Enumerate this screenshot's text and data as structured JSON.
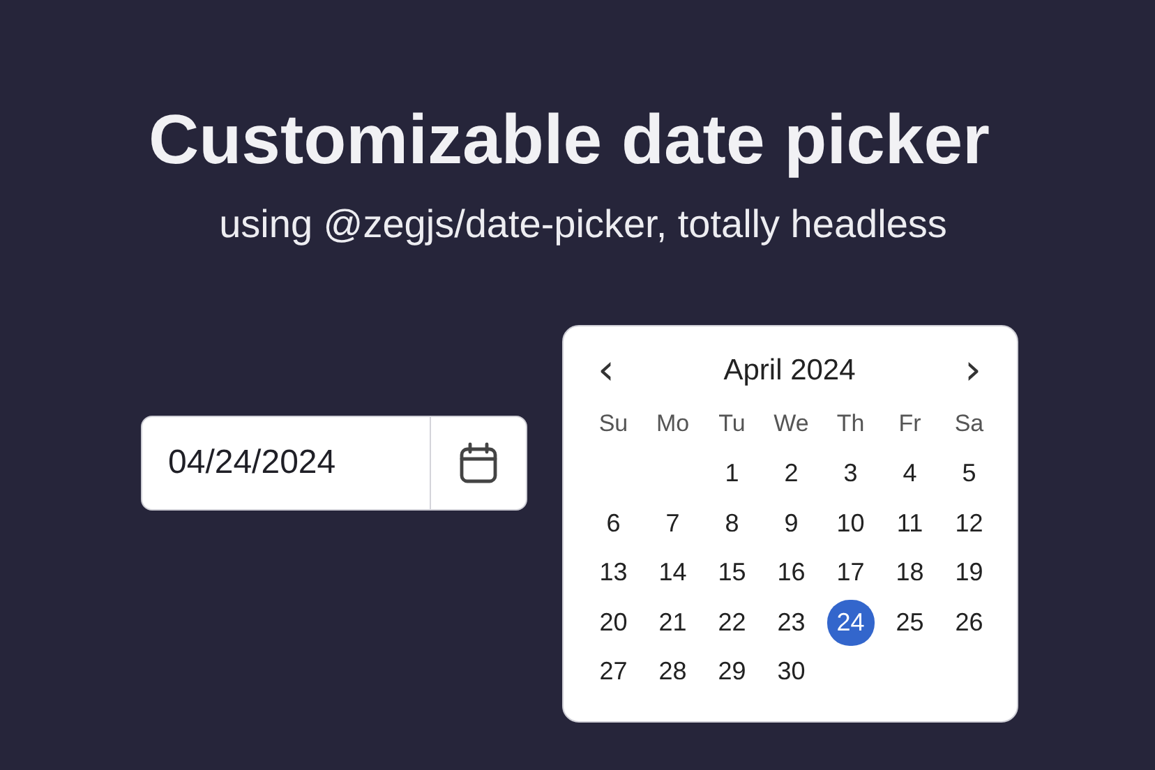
{
  "title": "Customizable date picker",
  "subtitle": "using @zegjs/date-picker, totally headless",
  "date_input": {
    "value": "04/24/2024"
  },
  "calendar": {
    "month_label": "April 2024",
    "prev": "‹",
    "next": "›",
    "weekdays": [
      "Su",
      "Mo",
      "Tu",
      "We",
      "Th",
      "Fr",
      "Sa"
    ],
    "weeks": [
      {
        "days": [
          {
            "label": "1",
            "selected": false
          },
          {
            "label": "2",
            "selected": false
          },
          {
            "label": "3",
            "selected": false
          },
          {
            "label": "4",
            "selected": false
          },
          {
            "label": "5",
            "selected": false
          }
        ]
      },
      {
        "days": [
          {
            "label": "6",
            "selected": false
          },
          {
            "label": "7",
            "selected": false
          },
          {
            "label": "8",
            "selected": false
          },
          {
            "label": "9",
            "selected": false
          },
          {
            "label": "10",
            "selected": false
          },
          {
            "label": "11",
            "selected": false
          },
          {
            "label": "12",
            "selected": false
          }
        ]
      },
      {
        "days": [
          {
            "label": "13",
            "selected": false
          },
          {
            "label": "14",
            "selected": false
          },
          {
            "label": "15",
            "selected": false
          },
          {
            "label": "16",
            "selected": false
          },
          {
            "label": "17",
            "selected": false
          },
          {
            "label": "18",
            "selected": false
          },
          {
            "label": "19",
            "selected": false
          }
        ]
      },
      {
        "days": [
          {
            "label": "20",
            "selected": false
          },
          {
            "label": "21",
            "selected": false
          },
          {
            "label": "22",
            "selected": false
          },
          {
            "label": "23",
            "selected": false
          },
          {
            "label": "24",
            "selected": true
          },
          {
            "label": "25",
            "selected": false
          },
          {
            "label": "26",
            "selected": false
          }
        ]
      },
      {
        "days": [
          {
            "label": "27",
            "selected": false
          },
          {
            "label": "28",
            "selected": false
          },
          {
            "label": "29",
            "selected": false
          },
          {
            "label": "30",
            "selected": false
          }
        ]
      }
    ]
  }
}
